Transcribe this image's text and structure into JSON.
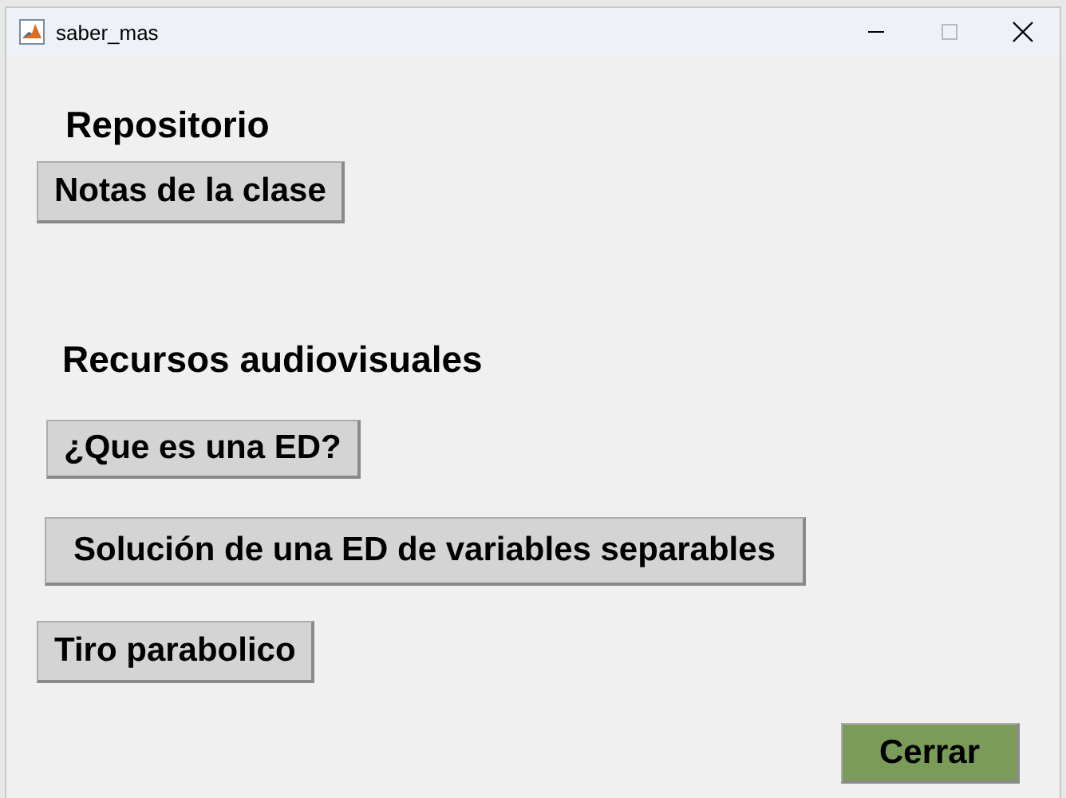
{
  "window": {
    "title": "saber_mas"
  },
  "sections": [
    {
      "heading": "Repositorio",
      "buttons": [
        "Notas de la clase"
      ]
    },
    {
      "heading": "Recursos audiovisuales",
      "buttons": [
        "¿Que es una ED?",
        "Solución de una ED de variables separables",
        "Tiro parabolico"
      ]
    }
  ],
  "close_button": "Cerrar"
}
